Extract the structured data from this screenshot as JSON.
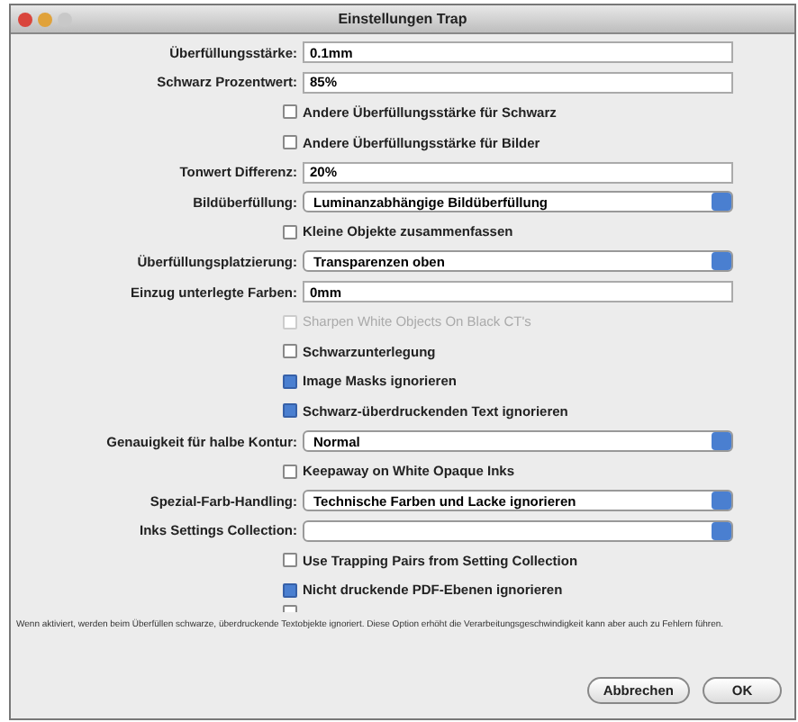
{
  "window": {
    "title": "Einstellungen Trap"
  },
  "rows": [
    {
      "kind": "text",
      "label": "Überfüllungsstärke:",
      "value": "0.1mm"
    },
    {
      "kind": "text",
      "label": "Schwarz Prozentwert:",
      "value": "85%"
    },
    {
      "kind": "checkbox",
      "label": "Andere Überfüllungsstärke für Schwarz",
      "checked": false,
      "disabled": false
    },
    {
      "kind": "checkbox",
      "label": "Andere Überfüllungsstärke für Bilder",
      "checked": false,
      "disabled": false
    },
    {
      "kind": "text",
      "label": "Tonwert Differenz:",
      "value": "20%"
    },
    {
      "kind": "select",
      "label": "Bildüberfüllung:",
      "value": "Luminanzabhängige Bildüberfüllung"
    },
    {
      "kind": "checkbox",
      "label": "Kleine Objekte zusammenfassen",
      "checked": false,
      "disabled": false
    },
    {
      "kind": "select",
      "label": "Überfüllungsplatzierung:",
      "value": "Transparenzen oben"
    },
    {
      "kind": "text",
      "label": "Einzug unterlegte Farben:",
      "value": "0mm"
    },
    {
      "kind": "checkbox",
      "label": "Sharpen White Objects On Black CT's",
      "checked": false,
      "disabled": true
    },
    {
      "kind": "checkbox",
      "label": "Schwarzunterlegung",
      "checked": false,
      "disabled": false
    },
    {
      "kind": "checkbox",
      "label": "Image Masks ignorieren",
      "checked": true,
      "disabled": false
    },
    {
      "kind": "checkbox",
      "label": "Schwarz-überdruckenden Text ignorieren",
      "checked": true,
      "disabled": false
    },
    {
      "kind": "select",
      "label": "Genauigkeit für halbe Kontur:",
      "value": "Normal"
    },
    {
      "kind": "checkbox",
      "label": "Keepaway on White Opaque Inks",
      "checked": false,
      "disabled": false
    },
    {
      "kind": "select",
      "label": "Spezial-Farb-Handling:",
      "value": "Technische Farben und Lacke ignorieren"
    },
    {
      "kind": "select",
      "label": "Inks Settings Collection:"
    },
    {
      "kind": "checkbox",
      "label": "Use Trapping Pairs from Setting Collection",
      "checked": false,
      "disabled": false
    },
    {
      "kind": "checkbox",
      "label": "Nicht druckende PDF-Ebenen ignorieren",
      "checked": true,
      "disabled": false
    },
    {
      "kind": "partial",
      "checked": false
    }
  ],
  "help_text": "Wenn aktiviert, werden beim Überfüllen schwarze, überdruckende Textobjekte ignoriert. Diese Option erhöht die Verarbeitungsgeschwindigkeit kann aber auch zu Fehlern führen.",
  "buttons": [
    {
      "label": "Abbrechen",
      "default": false
    },
    {
      "label": "OK",
      "default": false
    }
  ]
}
